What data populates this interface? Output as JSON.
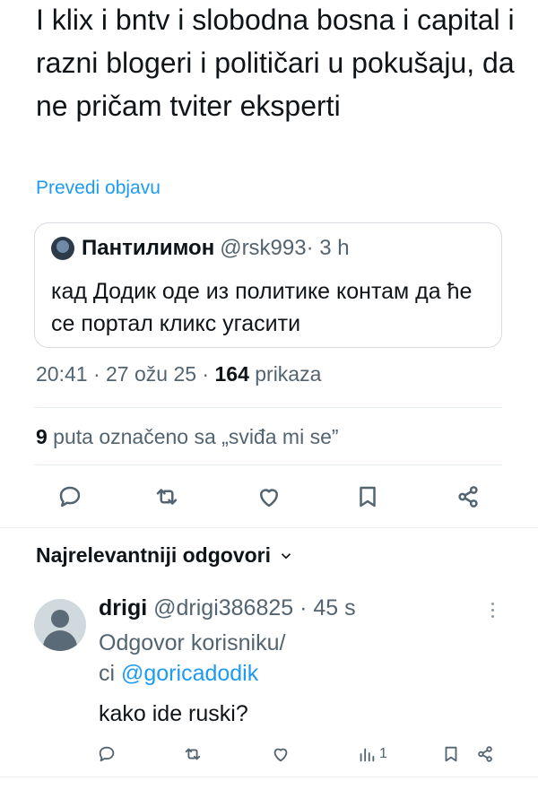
{
  "tweet": {
    "text": "I klix i bntv i slobodna bosna i capital i razni blogeri i političari u pokušaju, da ne pričam tviter eksperti",
    "translate_label": "Prevedi objavu"
  },
  "quote": {
    "name": "Пантилимон",
    "handle": "@rsk993",
    "time": " · 3 h",
    "text": "кад Додик оде из политике контам да ће се портал кликс угасити"
  },
  "meta": {
    "time": "20:41",
    "date": " · 27 ožu 25 · ",
    "views_count": "164",
    "views_label": " prikaza"
  },
  "likes": {
    "count": "9",
    "label": " puta označeno sa „sviđa mi se”"
  },
  "actions": {
    "icons": [
      "reply-icon",
      "retweet-icon",
      "like-icon",
      "bookmark-icon",
      "share-icon"
    ]
  },
  "replies": {
    "sort_label": "Najrelevantniji odgovori",
    "items": [
      {
        "name": "drigi",
        "handle": "@drigi386825",
        "time": " · 45 s",
        "reply_to_prefix": "Odgovor korisniku/",
        "reply_to_line2": "ci ",
        "mention": "@goricadodik",
        "text": "kako ide ruski?",
        "views": "1"
      }
    ]
  },
  "colors": {
    "accent": "#1d9bf0",
    "text": "#0f1419",
    "secondary": "#536471"
  }
}
